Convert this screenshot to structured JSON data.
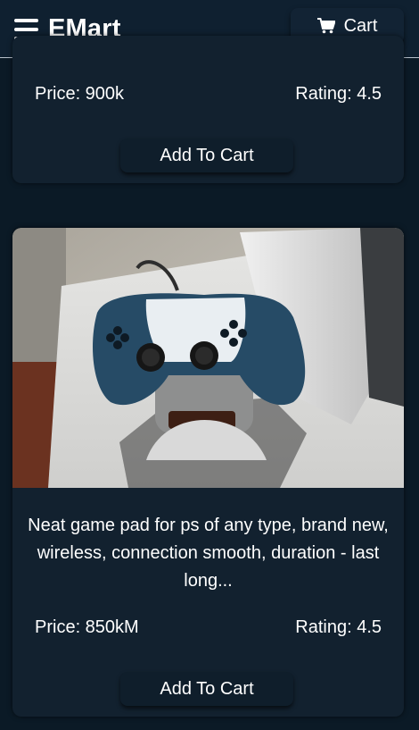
{
  "header": {
    "brand": "EMart",
    "cart_label": "Cart"
  },
  "products": [
    {
      "price": "Price: 900k",
      "rating": "Rating: 4.5",
      "add_label": "Add To Cart"
    },
    {
      "description": "Neat game pad for ps of any type, brand new, wireless, connection smooth, duration - last long...",
      "price": "Price: 850kM",
      "rating": "Rating: 4.5",
      "add_label": "Add To Cart"
    }
  ],
  "colors": {
    "background": "#0b1a26",
    "header": "#0f2030",
    "card": "#12212f",
    "button": "#0f1e2b",
    "text": "#ffffff"
  },
  "icons": {
    "menu": "hamburger-menu-icon",
    "cart": "shopping-cart-icon"
  }
}
